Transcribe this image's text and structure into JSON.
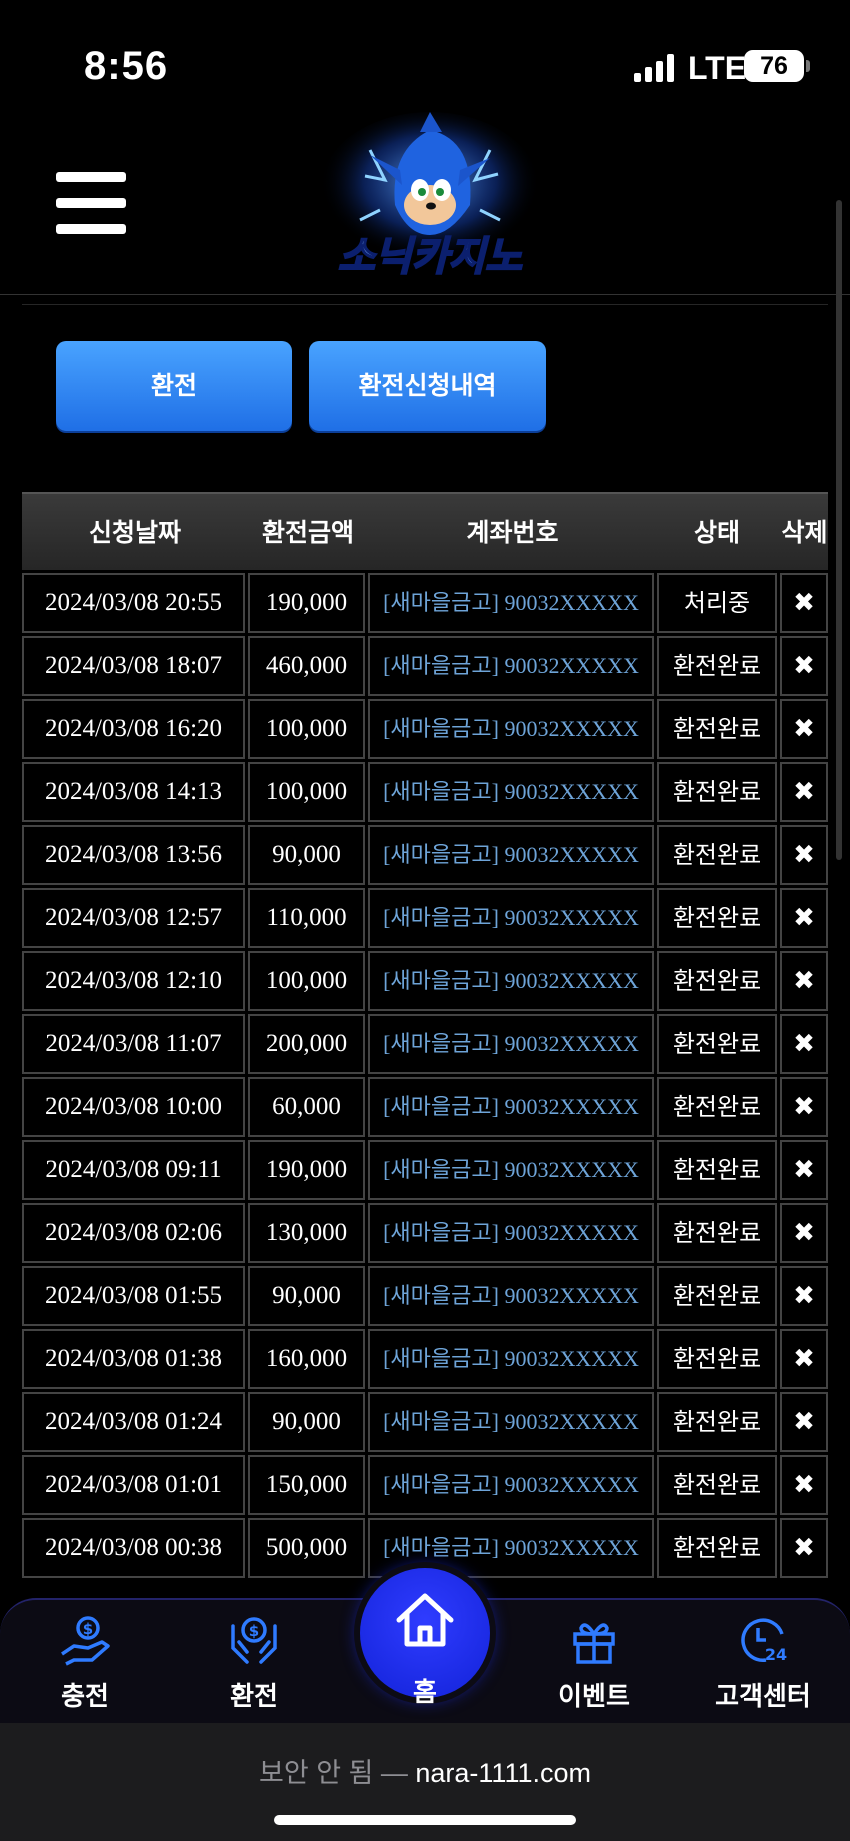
{
  "status_bar": {
    "time": "8:56",
    "network": "LTE",
    "battery": "76"
  },
  "header": {
    "logo_text": "소닉카지노"
  },
  "tabs": {
    "withdraw": "환전",
    "history": "환전신청내역"
  },
  "table": {
    "columns": [
      "신청날짜",
      "환전금액",
      "계좌번호",
      "상태",
      "삭제"
    ],
    "rows": [
      {
        "date": "2024/03/08 20:55",
        "amount": "190,000",
        "account": "[새마을금고] 90032XXXXX",
        "status": "처리중",
        "delete": "✖"
      },
      {
        "date": "2024/03/08 18:07",
        "amount": "460,000",
        "account": "[새마을금고] 90032XXXXX",
        "status": "환전완료",
        "delete": "✖"
      },
      {
        "date": "2024/03/08 16:20",
        "amount": "100,000",
        "account": "[새마을금고] 90032XXXXX",
        "status": "환전완료",
        "delete": "✖"
      },
      {
        "date": "2024/03/08 14:13",
        "amount": "100,000",
        "account": "[새마을금고] 90032XXXXX",
        "status": "환전완료",
        "delete": "✖"
      },
      {
        "date": "2024/03/08 13:56",
        "amount": "90,000",
        "account": "[새마을금고] 90032XXXXX",
        "status": "환전완료",
        "delete": "✖"
      },
      {
        "date": "2024/03/08 12:57",
        "amount": "110,000",
        "account": "[새마을금고] 90032XXXXX",
        "status": "환전완료",
        "delete": "✖"
      },
      {
        "date": "2024/03/08 12:10",
        "amount": "100,000",
        "account": "[새마을금고] 90032XXXXX",
        "status": "환전완료",
        "delete": "✖"
      },
      {
        "date": "2024/03/08 11:07",
        "amount": "200,000",
        "account": "[새마을금고] 90032XXXXX",
        "status": "환전완료",
        "delete": "✖"
      },
      {
        "date": "2024/03/08 10:00",
        "amount": "60,000",
        "account": "[새마을금고] 90032XXXXX",
        "status": "환전완료",
        "delete": "✖"
      },
      {
        "date": "2024/03/08 09:11",
        "amount": "190,000",
        "account": "[새마을금고] 90032XXXXX",
        "status": "환전완료",
        "delete": "✖"
      },
      {
        "date": "2024/03/08 02:06",
        "amount": "130,000",
        "account": "[새마을금고] 90032XXXXX",
        "status": "환전완료",
        "delete": "✖"
      },
      {
        "date": "2024/03/08 01:55",
        "amount": "90,000",
        "account": "[새마을금고] 90032XXXXX",
        "status": "환전완료",
        "delete": "✖"
      },
      {
        "date": "2024/03/08 01:38",
        "amount": "160,000",
        "account": "[새마을금고] 90032XXXXX",
        "status": "환전완료",
        "delete": "✖"
      },
      {
        "date": "2024/03/08 01:24",
        "amount": "90,000",
        "account": "[새마을금고] 90032XXXXX",
        "status": "환전완료",
        "delete": "✖"
      },
      {
        "date": "2024/03/08 01:01",
        "amount": "150,000",
        "account": "[새마을금고] 90032XXXXX",
        "status": "환전완료",
        "delete": "✖"
      },
      {
        "date": "2024/03/08 00:38",
        "amount": "500,000",
        "account": "[새마을금고] 90032XXXXX",
        "status": "환전완료",
        "delete": "✖"
      }
    ]
  },
  "bottom_nav": {
    "charge": {
      "label": "충전",
      "icon": "hand-coin-icon"
    },
    "withdraw": {
      "label": "환전",
      "icon": "hands-dollar-icon"
    },
    "home": {
      "label": "홈",
      "icon": "home-icon"
    },
    "event": {
      "label": "이벤트",
      "icon": "gift-icon"
    },
    "support": {
      "label": "고객센터",
      "icon": "support-24-icon"
    }
  },
  "browser": {
    "security": "보안 안 됨 — ",
    "host": "nara-1111.com"
  },
  "colors": {
    "accent": "#1f6fe6",
    "account_text": "#6ea4d8",
    "home_button": "#1222d8"
  }
}
